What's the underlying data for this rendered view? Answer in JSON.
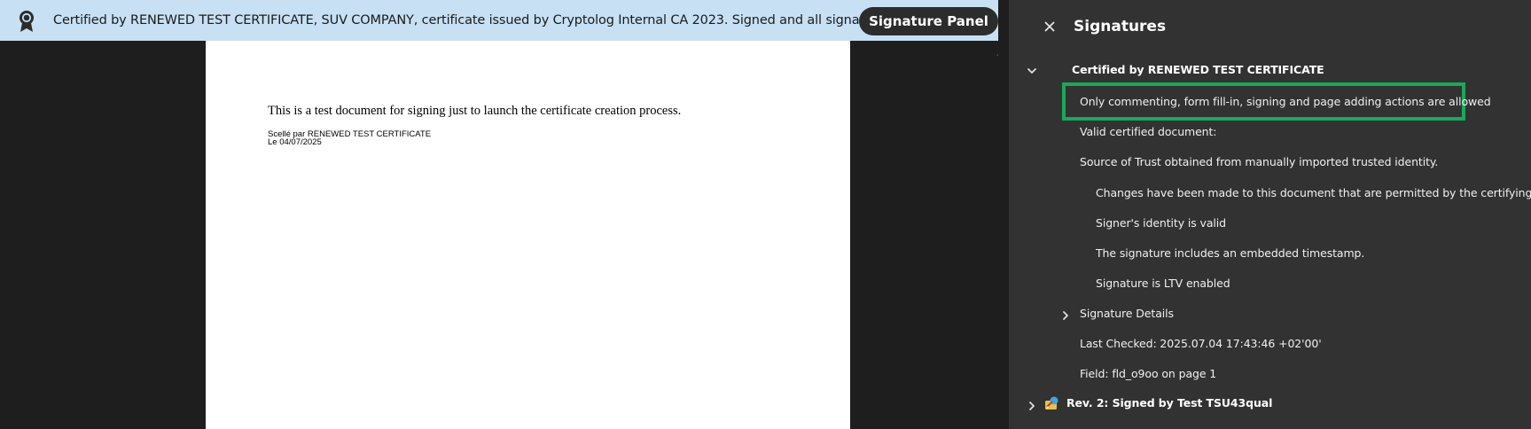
{
  "cert_bar": {
    "message": "Certified by RENEWED TEST CERTIFICATE, SUV COMPANY, certificate issued by Cryptolog Internal CA 2023. Signed and all signatures are valid.",
    "button_label": "Signature Panel",
    "icon": "ribbon-badge-icon"
  },
  "document": {
    "body_text": "This is a test document for signing just to launch the certificate creation process.",
    "seal_line_1": "Scellé par RENEWED TEST CERTIFICATE",
    "seal_line_2": "Le 04/07/2025"
  },
  "panel": {
    "title": "Signatures",
    "close_icon": "close-icon",
    "certified_header": "Certified by RENEWED TEST CERTIFICATE",
    "permissions": "Only commenting, form fill-in, signing and page adding actions are allowed",
    "valid_certified": "Valid certified document:",
    "source_of_trust": "Source of Trust obtained from manually imported trusted identity.",
    "details": [
      "Changes have been made to this document that are permitted by the certifying party",
      "Signer's identity is valid",
      "The signature includes an embedded timestamp.",
      "Signature is LTV enabled"
    ],
    "signature_details": "Signature Details",
    "last_checked": "Last Checked: 2025.07.04 17:43:46 +02'00'",
    "field": "Field: fld_o9oo on page 1",
    "rev2": "Rev. 2: Signed by Test TSU43qual"
  },
  "colors": {
    "cert_bar_bg": "#c7e0f4",
    "panel_bg": "#323232",
    "highlight": "#1aa85a"
  }
}
